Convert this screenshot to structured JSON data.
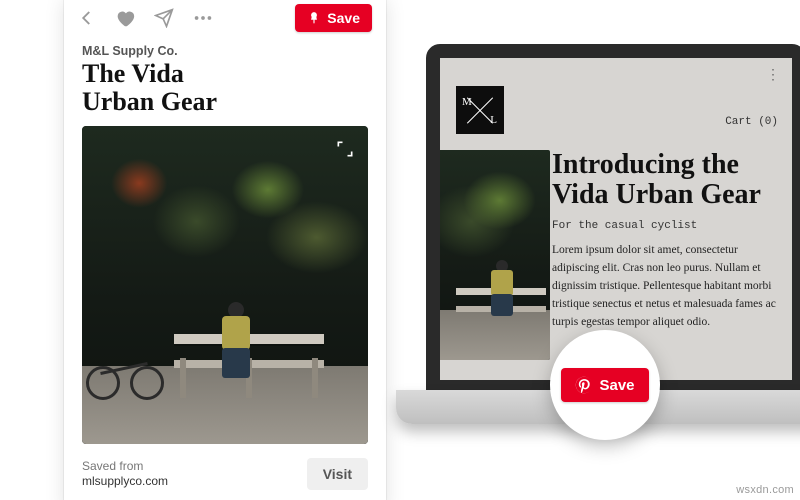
{
  "pin": {
    "source": "M&L Supply Co.",
    "title_line1": "The Vida",
    "title_line2": "Urban Gear",
    "save_label": "Save",
    "saved_from_label": "Saved from",
    "saved_from_domain": "mlsupplyco.com",
    "visit_label": "Visit"
  },
  "site": {
    "brand_letters": {
      "m": "M",
      "l": "L"
    },
    "cart_label": "Cart (0)",
    "headline": "Introducing the Vida Urban Gear",
    "subhead": "For the casual cyclist",
    "body": "Lorem ipsum dolor sit amet, consectetur adipiscing elit. Cras non leo purus. Nullam et dignissim tristique. Pellentesque habitant morbi tristique senectus et netus et malesuada fames ac turpis egestas tempor aliquet odio.",
    "save_label": "Save",
    "menu_glyph": "⋮"
  },
  "watermark": "wsxdn.com"
}
